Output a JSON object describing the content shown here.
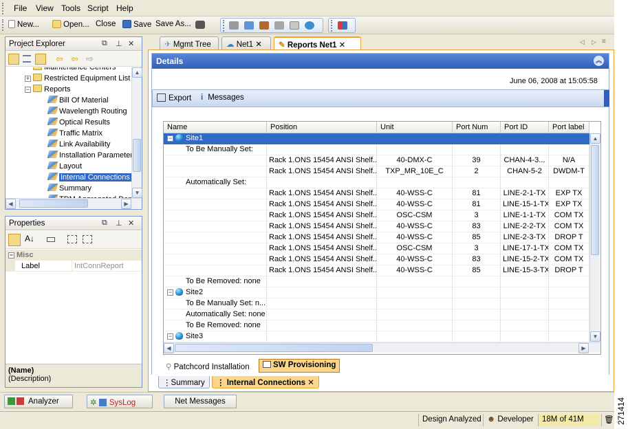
{
  "menu": [
    "File",
    "View",
    "Tools",
    "Script",
    "Help"
  ],
  "toolbar": {
    "new_label": "New...",
    "open_label": "Open...",
    "close_label": "Close",
    "save_label": "Save",
    "save_as_label": "Save As..."
  },
  "project_explorer": {
    "title": "Project Explorer",
    "items": [
      {
        "label": "Maintenance Centers",
        "type": "folder",
        "indent": 2
      },
      {
        "label": "Restricted Equipment List",
        "type": "folder",
        "indent": 2,
        "toggle": "+"
      },
      {
        "label": "Reports",
        "type": "folder",
        "indent": 2,
        "toggle": "-"
      },
      {
        "label": "Bill Of Material",
        "type": "report",
        "indent": 3
      },
      {
        "label": "Wavelength Routing",
        "type": "report",
        "indent": 3
      },
      {
        "label": "Optical Results",
        "type": "report",
        "indent": 3
      },
      {
        "label": "Traffic Matrix",
        "type": "report",
        "indent": 3
      },
      {
        "label": "Link Availability",
        "type": "report",
        "indent": 3
      },
      {
        "label": "Installation Parameters",
        "type": "report",
        "indent": 3
      },
      {
        "label": "Layout",
        "type": "report",
        "indent": 3
      },
      {
        "label": "Internal Connections",
        "type": "report",
        "indent": 3,
        "selected": true
      },
      {
        "label": "Summary",
        "type": "report",
        "indent": 3
      },
      {
        "label": "TDM Aggregated Demands",
        "type": "report",
        "indent": 3
      }
    ]
  },
  "properties": {
    "title": "Properties",
    "category": "Misc",
    "rows": [
      {
        "name": "Label",
        "value": "IntConnReport"
      }
    ],
    "help_name": "(Name)",
    "help_desc": "(Description)"
  },
  "tabs": [
    "Mgmt Tree",
    "Net1",
    "Reports Net1"
  ],
  "details": {
    "title": "Details",
    "timestamp": "June 06, 2008 at 15:05:58",
    "export_label": "Export",
    "messages_label": "Messages"
  },
  "grid": {
    "columns": [
      "Name",
      "Position",
      "Unit",
      "Port Num",
      "Port ID",
      "Port label"
    ],
    "rows": [
      {
        "kind": "site",
        "name": "Site1",
        "toggle": "-",
        "selected": true
      },
      {
        "kind": "group",
        "name": "To Be Manually Set:"
      },
      {
        "kind": "data",
        "position": "Rack 1.ONS 15454 ANSI Shelf...",
        "unit": "40-DMX-C",
        "port_num": "39",
        "port_id": "CHAN-4-3...",
        "port_label": "N/A"
      },
      {
        "kind": "data",
        "position": "Rack 1.ONS 15454 ANSI Shelf...",
        "unit": "TXP_MR_10E_C",
        "port_num": "2",
        "port_id": "CHAN-5-2",
        "port_label": "DWDM-T"
      },
      {
        "kind": "group",
        "name": "Automatically Set:"
      },
      {
        "kind": "data",
        "position": "Rack 1.ONS 15454 ANSI Shelf...",
        "unit": "40-WSS-C",
        "port_num": "81",
        "port_id": "LINE-2-1-TX",
        "port_label": "EXP TX"
      },
      {
        "kind": "data",
        "position": "Rack 1.ONS 15454 ANSI Shelf...",
        "unit": "40-WSS-C",
        "port_num": "81",
        "port_id": "LINE-15-1-TX",
        "port_label": "EXP TX"
      },
      {
        "kind": "data",
        "position": "Rack 1.ONS 15454 ANSI Shelf...",
        "unit": "OSC-CSM",
        "port_num": "3",
        "port_id": "LINE-1-1-TX",
        "port_label": "COM TX"
      },
      {
        "kind": "data",
        "position": "Rack 1.ONS 15454 ANSI Shelf...",
        "unit": "40-WSS-C",
        "port_num": "83",
        "port_id": "LINE-2-2-TX",
        "port_label": "COM TX"
      },
      {
        "kind": "data",
        "position": "Rack 1.ONS 15454 ANSI Shelf...",
        "unit": "40-WSS-C",
        "port_num": "85",
        "port_id": "LINE-2-3-TX",
        "port_label": "DROP T"
      },
      {
        "kind": "data",
        "position": "Rack 1.ONS 15454 ANSI Shelf...",
        "unit": "OSC-CSM",
        "port_num": "3",
        "port_id": "LINE-17-1-TX",
        "port_label": "COM TX"
      },
      {
        "kind": "data",
        "position": "Rack 1.ONS 15454 ANSI Shelf...",
        "unit": "40-WSS-C",
        "port_num": "83",
        "port_id": "LINE-15-2-TX",
        "port_label": "COM TX"
      },
      {
        "kind": "data",
        "position": "Rack 1.ONS 15454 ANSI Shelf...",
        "unit": "40-WSS-C",
        "port_num": "85",
        "port_id": "LINE-15-3-TX",
        "port_label": "DROP T"
      },
      {
        "kind": "group",
        "name": "To Be Removed: none"
      },
      {
        "kind": "site",
        "name": "Site2",
        "toggle": "-"
      },
      {
        "kind": "group",
        "name": "To Be Manually Set: n..."
      },
      {
        "kind": "group",
        "name": "Automatically Set: none"
      },
      {
        "kind": "group",
        "name": "To Be Removed: none"
      },
      {
        "kind": "site",
        "name": "Site3",
        "toggle": "-"
      }
    ]
  },
  "subtabs": {
    "patchcord": "Patchcord Installation",
    "sw": "SW Provisioning"
  },
  "bottom_tabs": {
    "summary": "Summary",
    "internal": "Internal Connections"
  },
  "bottom_panels": {
    "analyzer": "Analyzer",
    "syslog": "SysLog",
    "net_messages": "Net Messages"
  },
  "status": {
    "state": "Design Analyzed",
    "role": "Developer",
    "memory": "18M of 41M"
  },
  "figure_id": "271414",
  "colors": {
    "accent_blue": "#316ac5",
    "tab_orange": "#f0a030",
    "header_blue": "#2f5fb9"
  }
}
